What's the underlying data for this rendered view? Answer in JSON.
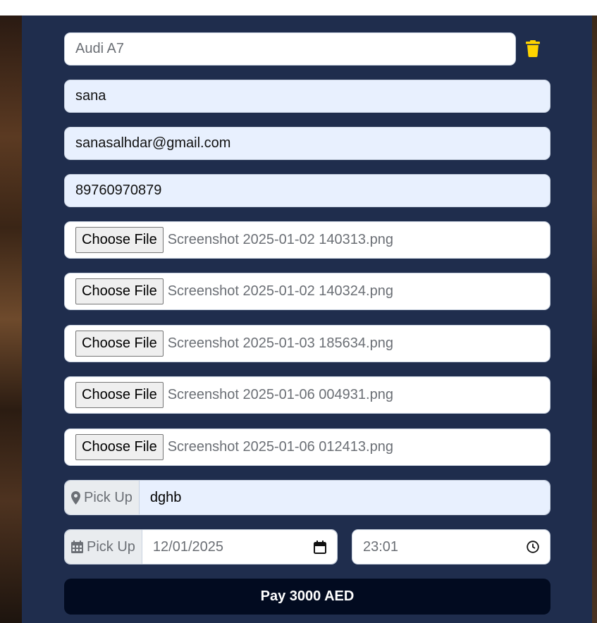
{
  "form": {
    "car_name": "Audi A7",
    "name": "sana",
    "email": "sanasalhdar@gmail.com",
    "phone": "89760970879",
    "files": [
      {
        "button": "Choose File",
        "name": "Screenshot 2025-01-02 140313.png"
      },
      {
        "button": "Choose File",
        "name": "Screenshot 2025-01-02 140324.png"
      },
      {
        "button": "Choose File",
        "name": "Screenshot 2025-01-03 185634.png"
      },
      {
        "button": "Choose File",
        "name": "Screenshot 2025-01-06 004931.png"
      },
      {
        "button": "Choose File",
        "name": "Screenshot 2025-01-06 012413.png"
      }
    ],
    "pickup_location": {
      "label": "Pick Up",
      "value": "dghb",
      "icon": "map-marker-icon"
    },
    "pickup_date": {
      "label": "Pick Up",
      "date": "12/01/2025",
      "time": "23:01",
      "icon": "calendar-icon"
    },
    "pay_label": "Pay 3000 AED"
  },
  "colors": {
    "panel": "#1f2d4d",
    "trash": "#ffd400",
    "pay_button": "#020b20",
    "autofill": "#e8f0fe"
  }
}
